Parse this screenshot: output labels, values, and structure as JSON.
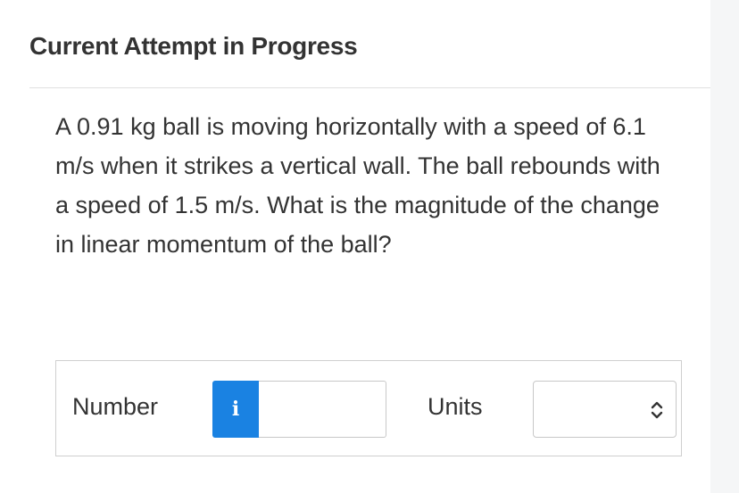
{
  "header": {
    "title": "Current Attempt in Progress"
  },
  "question": {
    "text": "A 0.91 kg ball is moving horizontally with a speed of 6.1 m/s when it strikes a vertical wall. The ball rebounds with a speed of 1.5 m/s. What is the magnitude of the change in linear momentum of the ball?"
  },
  "answer": {
    "number_label": "Number",
    "info_icon": "i",
    "number_value": "",
    "units_label": "Units",
    "units_value": ""
  },
  "colors": {
    "info_button": "#1a82e2",
    "text": "#333333",
    "border": "#cfcfcf"
  },
  "icons": [
    "info-icon",
    "chevron-updown-icon"
  ]
}
